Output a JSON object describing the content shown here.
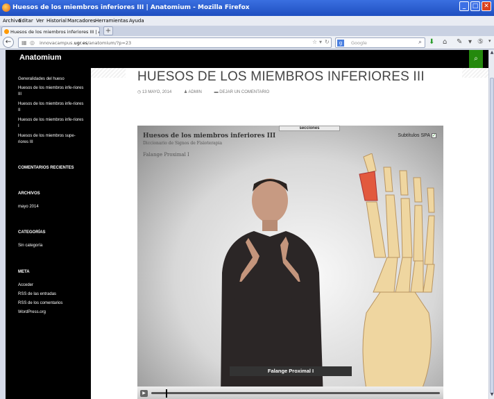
{
  "window": {
    "title": "Huesos de los miembros inferiores III | Anatomium - Mozilla Firefox"
  },
  "menu": [
    "Archivo",
    "Editar",
    "Ver",
    "Historial",
    "Marcadores",
    "Herramientas",
    "Ayuda"
  ],
  "tab": {
    "label": "Huesos de los miembros inferiores III | Anat...",
    "new_tab": "+"
  },
  "url": {
    "prefix": "innovacampus.",
    "domain": "ugr.es",
    "path": "/anatomium/?p=23"
  },
  "search": {
    "placeholder": "Google"
  },
  "site": {
    "title": "Anatomium"
  },
  "nav": [
    "Generalidades del hueso",
    "Huesos de los miembros infe-riores III",
    "Huesos de los miembros infe-riores II",
    "Huesos de los miembros infe-riores I",
    "Huesos de los miembros supe-riores III"
  ],
  "widgets": {
    "recent_comments": "COMENTARIOS RECIENTES",
    "archives": "ARCHIVOS",
    "archive_link": "mayo 2014",
    "categories": "CATEGORÍAS",
    "category_link": "Sin categoría",
    "meta": "META",
    "meta_links": [
      "Acceder",
      "RSS de las entradas",
      "RSS de los comentarios",
      "WordPress.org"
    ]
  },
  "post": {
    "title": "HUESOS DE LOS MIEMBROS INFERIORES III",
    "date": "13 MAYO, 2014",
    "author": "ADMIN",
    "comment": "DEJAR UN COMENTARIO"
  },
  "video": {
    "sections_tab": "secciones",
    "title": "Huesos de los miembros inferiores III",
    "subtitle": "Diccionario de Signos de Fisioterapia",
    "sign_label": "Falange Proximal I",
    "subtitles_toggle": "Subtítulos SPA",
    "caption": "Falange Proximal I",
    "progress": 0.05
  }
}
